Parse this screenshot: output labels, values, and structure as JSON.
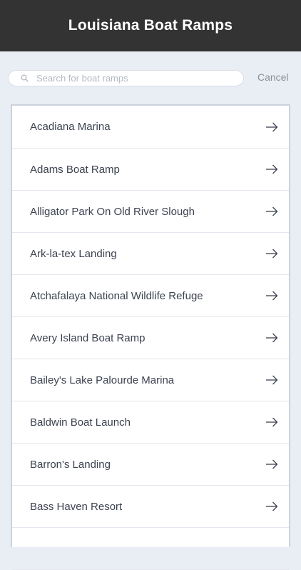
{
  "header": {
    "title": "Louisiana Boat Ramps"
  },
  "search": {
    "placeholder": "Search for boat ramps",
    "value": "",
    "icon": "search-icon",
    "cancel_label": "Cancel"
  },
  "list": {
    "items": [
      {
        "label": "Acadiana Marina",
        "icon": "arrow-right-icon"
      },
      {
        "label": "Adams Boat Ramp",
        "icon": "arrow-right-icon"
      },
      {
        "label": "Alligator Park On Old River Slough",
        "icon": "arrow-right-icon"
      },
      {
        "label": "Ark-la-tex Landing",
        "icon": "arrow-right-icon"
      },
      {
        "label": "Atchafalaya National Wildlife Refuge",
        "icon": "arrow-right-icon"
      },
      {
        "label": "Avery Island Boat Ramp",
        "icon": "arrow-right-icon"
      },
      {
        "label": "Bailey's Lake Palourde Marina",
        "icon": "arrow-right-icon"
      },
      {
        "label": "Baldwin Boat Launch",
        "icon": "arrow-right-icon"
      },
      {
        "label": "Barron's Landing",
        "icon": "arrow-right-icon"
      },
      {
        "label": "Bass Haven Resort",
        "icon": "arrow-right-icon"
      }
    ]
  },
  "colors": {
    "header_bg": "#333333",
    "page_bg": "#e9edf4",
    "text": "#3c4250",
    "muted": "#8a909a"
  }
}
